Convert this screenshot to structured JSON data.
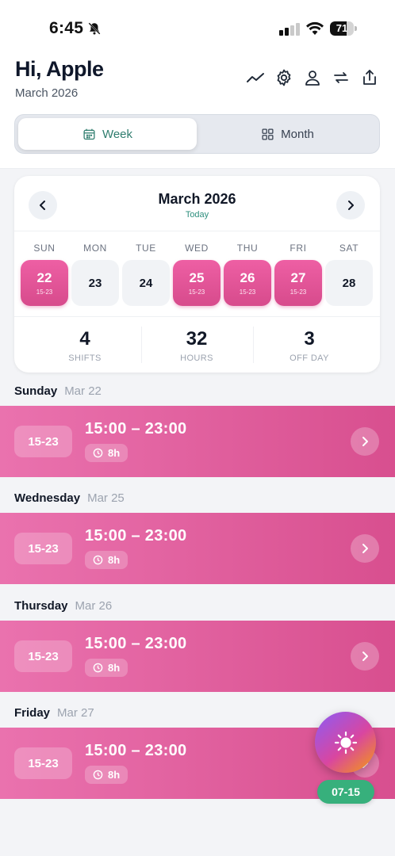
{
  "status_bar": {
    "time": "6:45",
    "battery_level": "71",
    "battery_fraction": 0.71
  },
  "header": {
    "greeting": "Hi, Apple",
    "subtitle": "March 2026",
    "icons": [
      "trend-icon",
      "gear-icon",
      "profile-icon",
      "swap-icon",
      "share-icon"
    ]
  },
  "view_toggle": {
    "week_label": "Week",
    "month_label": "Month",
    "selected": "Week"
  },
  "calendar": {
    "title": "March 2026",
    "today_label": "Today",
    "days": [
      {
        "name": "SUN",
        "date": "22",
        "tag": "15-23",
        "shift": true
      },
      {
        "name": "MON",
        "date": "23",
        "tag": "",
        "shift": false
      },
      {
        "name": "TUE",
        "date": "24",
        "tag": "",
        "shift": false
      },
      {
        "name": "WED",
        "date": "25",
        "tag": "15-23",
        "shift": true
      },
      {
        "name": "THU",
        "date": "26",
        "tag": "15-23",
        "shift": true
      },
      {
        "name": "FRI",
        "date": "27",
        "tag": "15-23",
        "shift": true
      },
      {
        "name": "SAT",
        "date": "28",
        "tag": "",
        "shift": false
      }
    ],
    "stats": [
      {
        "value": "4",
        "label": "SHIFTS"
      },
      {
        "value": "32",
        "label": "HOURS"
      },
      {
        "value": "3",
        "label": "OFF DAY"
      }
    ]
  },
  "shifts": [
    {
      "day": "Sunday",
      "date": "Mar 22",
      "chip": "15-23",
      "time": "15:00 – 23:00",
      "duration": "8h"
    },
    {
      "day": "Wednesday",
      "date": "Mar 25",
      "chip": "15-23",
      "time": "15:00 – 23:00",
      "duration": "8h"
    },
    {
      "day": "Thursday",
      "date": "Mar 26",
      "chip": "15-23",
      "time": "15:00 – 23:00",
      "duration": "8h"
    },
    {
      "day": "Friday",
      "date": "Mar 27",
      "chip": "15-23",
      "time": "15:00 – 23:00",
      "duration": "8h"
    }
  ],
  "fab": {
    "icon": "sun-icon",
    "badge": "07-15"
  },
  "colors": {
    "shift_pink": "#e0579a",
    "accent_teal": "#2f7d6e",
    "badge_green": "#37b07c"
  }
}
